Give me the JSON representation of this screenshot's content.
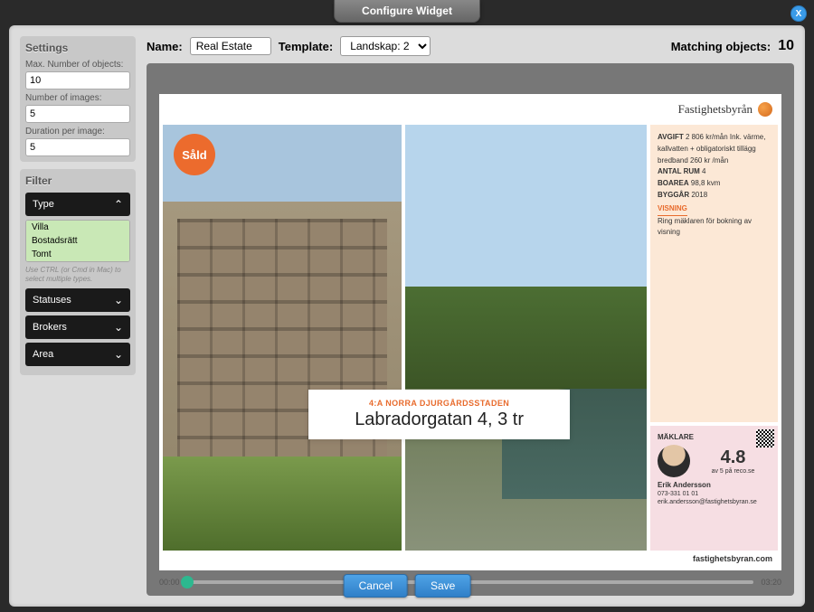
{
  "window": {
    "title": "Configure Widget",
    "close": "X"
  },
  "topbar": {
    "name_label": "Name:",
    "name_value": "Real Estate",
    "template_label": "Template:",
    "template_value": "Landskap: 2",
    "matching_label": "Matching objects:",
    "matching_count": "10"
  },
  "settings": {
    "title": "Settings",
    "max_objects_label": "Max. Number of objects:",
    "max_objects_value": "10",
    "num_images_label": "Number of images:",
    "num_images_value": "5",
    "duration_label": "Duration per image:",
    "duration_value": "5"
  },
  "filter": {
    "title": "Filter",
    "type_label": "Type",
    "type_items": {
      "0": "Villa",
      "1": "Bostadsrätt",
      "2": "Tomt"
    },
    "hint": "Use CTRL (or Cmd in Mac) to select multiple types.",
    "statuses_label": "Statuses",
    "brokers_label": "Brokers",
    "area_label": "Area"
  },
  "slide": {
    "brand": "Fastighetsbyrån",
    "sold_badge": "Såld",
    "subtitle": "4:A NORRA DJURGÅRDSSTADEN",
    "title": "Labradorgatan 4, 3 tr",
    "info": {
      "avgift_label": "AVGIFT",
      "avgift_value": "2 806 kr/mån Ink. värme, kallvatten + obligatoriskt tillägg bredband 260 kr /mån",
      "rum_label": "ANTAL RUM",
      "rum_value": "4",
      "boarea_label": "BOAREA",
      "boarea_value": "98,8 kvm",
      "byggar_label": "BYGGÅR",
      "byggar_value": "2018",
      "visning_label": "VISNING",
      "visning_text": "Ring mäklaren för bokning av visning"
    },
    "broker": {
      "label": "MÄKLARE",
      "rating": "4.8",
      "rating_src": "av 5 på reco.se",
      "name": "Erik Andersson",
      "phone": "073-331 01 01",
      "email": "erik.andersson@fastighetsbyran.se"
    },
    "footer_url": "fastighetsbyran.com"
  },
  "timeline": {
    "start": "00:00",
    "end": "03:20"
  },
  "buttons": {
    "cancel": "Cancel",
    "save": "Save"
  }
}
